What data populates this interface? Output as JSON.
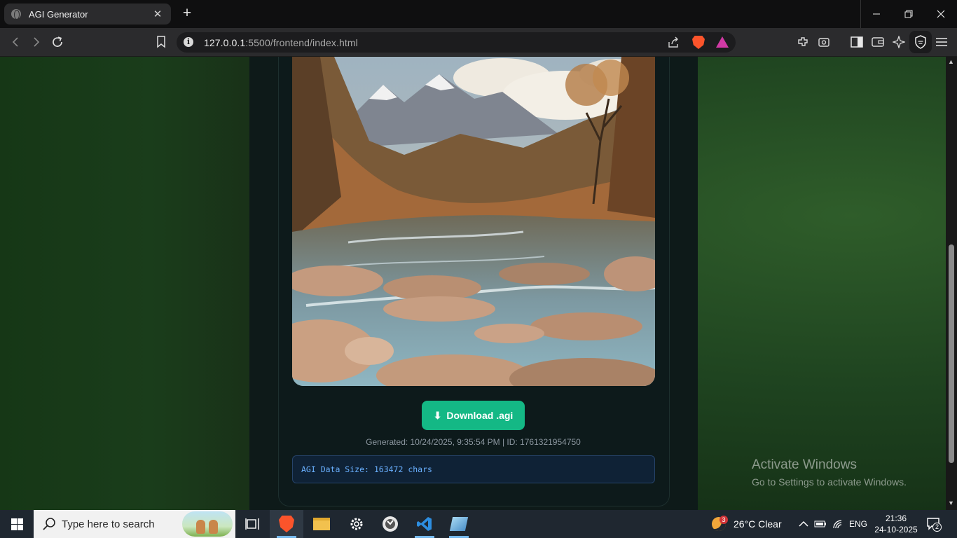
{
  "browser": {
    "tab_title": "AGI Generator",
    "tab_close": "✕",
    "new_tab": "+",
    "url_host": "127.0.0.1",
    "url_rest": ":5500/frontend/index.html"
  },
  "page": {
    "download_label": "Download .agi",
    "download_icon": "⬇",
    "generated_info": "Generated: 10/24/2025, 9:35:54 PM | ID: 1761321954750",
    "data_size": "AGI Data Size: 163472 chars",
    "image_subject": "painted mountain river landscape with autumn trees"
  },
  "watermark": {
    "title": "Activate Windows",
    "subtitle": "Go to Settings to activate Windows."
  },
  "taskbar": {
    "search_placeholder": "Type here to search",
    "weather_badge": "3",
    "weather_text": "26°C  Clear",
    "language": "ENG",
    "time": "21:36",
    "date": "24-10-2025",
    "notification_count": "2"
  },
  "colors": {
    "accent_button": "#14b885",
    "page_bg_green": "#1f4420",
    "card_bg": "#0d1a1b",
    "data_text": "#6ab0ff"
  }
}
